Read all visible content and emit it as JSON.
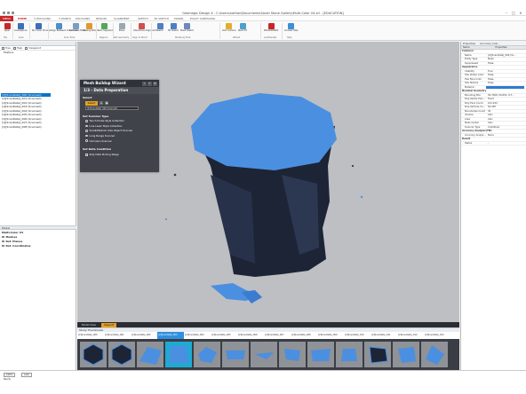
{
  "app": {
    "title": "Geomagic Design X - C:\\Users\\nathan\\Documents\\Sarah Stone Gallery\\Multi-Color V4.xrl - [EDUCATION]",
    "window_controls": [
      "–",
      "□",
      "×"
    ]
  },
  "ribbon": {
    "tabs": [
      "MENU",
      "HOME",
      "3 POLYGONS",
      "3 POINTS",
      "POLYGONS",
      "REGION",
      "ALIGNMENT",
      "SKETCH",
      "3D SKETCH",
      "MODEL",
      "EXACT SURFACING"
    ],
    "active_tab": "HOME",
    "buttons": [
      {
        "label": "Open",
        "color": "#c7262a"
      },
      {
        "label": "LiveCapture",
        "color": "#3b6fb6"
      },
      {
        "label": "Run Scan Process",
        "color": "#3b6fb6"
      },
      {
        "label": "Align Between Scan Data",
        "color": "#4d8fcc"
      },
      {
        "label": "Decimate Mesh",
        "color": "#7a9cc6"
      },
      {
        "label": "Healing Wizard",
        "color": "#e09a2b"
      },
      {
        "label": "Auto Segment",
        "color": "#58a65c"
      },
      {
        "label": "Plane",
        "color": "#9aa7b6"
      },
      {
        "label": "Interactive Alignment",
        "color": "#cf4f4f"
      },
      {
        "label": "Sketch",
        "color": "#4f7fc2"
      },
      {
        "label": "3D Sketch",
        "color": "#4f7fc2"
      },
      {
        "label": "Mesh Sketch",
        "color": "#6d8ab8"
      },
      {
        "label": "Auto Surface",
        "color": "#e0b02b"
      },
      {
        "label": "Mesh Fit",
        "color": "#4aa0d0"
      },
      {
        "label": "SOLIDWORKS",
        "color": "#c7262a"
      },
      {
        "label": "Context Help",
        "color": "#3d8fd6"
      }
    ],
    "groups": [
      "File",
      "Scan",
      "Scan Tools",
      "Regions",
      "Ref. Geometry",
      "Align to World",
      "Modeling Tools",
      "Wizard",
      "LiveTransfer",
      "Help"
    ]
  },
  "left_panel": {
    "tabs": [
      "Tree",
      "Help",
      "Viewpoint"
    ],
    "feature_header": "Feature",
    "features": [
      "[1][ScanData]_000 (Scanned)",
      "[1][ScanData]_001 (Scanned)",
      "[1][ScanData]_002 (Scanned)",
      "[1][ScanData]_003 (Scanned)",
      "[1][ScanData]_004 (Scanned)",
      "[1][ScanData]_005 (Scanned)",
      "[1][ScanData]_006 (Scanned)",
      "[1][ScanData]_007 (Scanned)",
      "[1][ScanData]_008 (Scanned)"
    ],
    "model_header": "Model",
    "model_tree": {
      "root": "Multi-Color V4",
      "items": [
        "Meshes",
        "Ref. Planes",
        "Ref. Coordinates"
      ]
    }
  },
  "wizard": {
    "title": "Mesh Buildup Wizard",
    "step": "1/3 - Data Preparation",
    "select_section": "Select",
    "select_button": "Select",
    "selected_item": "[2][ScanData]_000 (Scanned)",
    "scanner_type_section": "Set Scanner Type",
    "scanner_types": [
      "Touch Probe Style Collection",
      "Line Laser Style Collection",
      "Small/Medium Size Object Scanner",
      "Long Range Scanner",
      "Unknown Scanner"
    ],
    "data_condition_section": "Set Data Condition",
    "data_condition_option": "Skip Data Picking Stage"
  },
  "viewport": {
    "tabs": [
      "Model View",
      "Support"
    ],
    "active_tab": "Support",
    "mesh_color": "#4b8fe0"
  },
  "thumbnails": {
    "header": "Study Thumbnails",
    "names": [
      "[2]ScanData_000",
      "[2]ScanData_001",
      "[2]ScanData_002",
      "[2]ScanData_003",
      "[2]ScanData_004",
      "[2]ScanData_005",
      "[2]ScanData_006",
      "[2]ScanData_007",
      "[2]ScanData_008",
      "[2]ScanData_009",
      "[2]ScanData_010",
      "[2]ScanData_011",
      "[2]ScanData_012",
      "[2]ScanData_013"
    ],
    "selected_index": 3
  },
  "right_panel": {
    "tabs": [
      "Properties",
      "Accuracy Anal..."
    ],
    "columns": [
      "Name",
      "Properties"
    ],
    "rows": [
      {
        "type": "section",
        "label": "Common"
      },
      {
        "key": "Name",
        "value": "[2][ScanData]_000 (Sc..."
      },
      {
        "key": "Entity Type",
        "value": "Mesh"
      },
      {
        "key": "Suppressed",
        "value": "False"
      },
      {
        "type": "section",
        "label": "Appearance"
      },
      {
        "key": "Visibility",
        "value": "True"
      },
      {
        "key": "Has Vertex Color",
        "value": "False"
      },
      {
        "key": "Has Face Color",
        "value": "False"
      },
      {
        "key": "Has Texture",
        "value": "False"
      },
      {
        "key": "Material",
        "value": "",
        "bar": true
      },
      {
        "type": "section",
        "label": "Nominal Geometry"
      },
      {
        "key": "Bounding Box",
        "value": "50.7268, 50.652, 8.7..."
      },
      {
        "key": "Poly-Vertex Prec...",
        "value": "Fixed"
      },
      {
        "key": "Poly-Face Count",
        "value": "101,244"
      },
      {
        "key": "Poly-Vertices Co...",
        "value": "50,265"
      },
      {
        "key": "Boundaries Count",
        "value": "30"
      },
      {
        "key": "Volume",
        "value": "Calc."
      },
      {
        "key": "Area",
        "value": "Calc."
      },
      {
        "key": "Mass Center",
        "value": "Calc."
      },
      {
        "key": "Scanner Type",
        "value": "Undefined"
      },
      {
        "type": "section",
        "label": "Accuracy Analyzer(TM)"
      },
      {
        "key": "Accuracy Analyz...",
        "value": "None"
      },
      {
        "type": "section",
        "label": "Result"
      },
      {
        "key": "Status",
        "value": "–"
      }
    ]
  },
  "statusbar": {
    "fields": [
      "100%",
      "Auto",
      "Ready"
    ]
  }
}
